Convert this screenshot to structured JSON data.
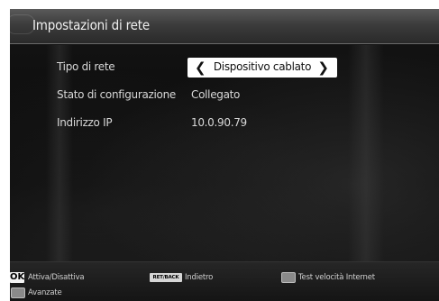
{
  "header": {
    "title": "Impostazioni di rete"
  },
  "settings": [
    {
      "label": "Tipo di rete",
      "value": "Dispositivo cablato"
    },
    {
      "label": "Stato di configurazione",
      "value": "Collegato"
    },
    {
      "label": "Indirizzo IP",
      "value": "10.0.90.79"
    }
  ],
  "footer": {
    "ok_key": "OK",
    "ok_action": "Attiva/Disattiva",
    "retback_key": "RET/BACK",
    "retback_action": "Indietro",
    "speedtest_action": "Test velocità Internet",
    "advanced_action": "Avanzate"
  },
  "icons": {
    "selector_left": "chevron-left-icon",
    "selector_right": "chevron-right-icon"
  },
  "colors": {
    "background": "#0b0b0b",
    "header": "#3c3c3c",
    "text": "#d8d8d8",
    "selector_bg": "#ffffff"
  }
}
